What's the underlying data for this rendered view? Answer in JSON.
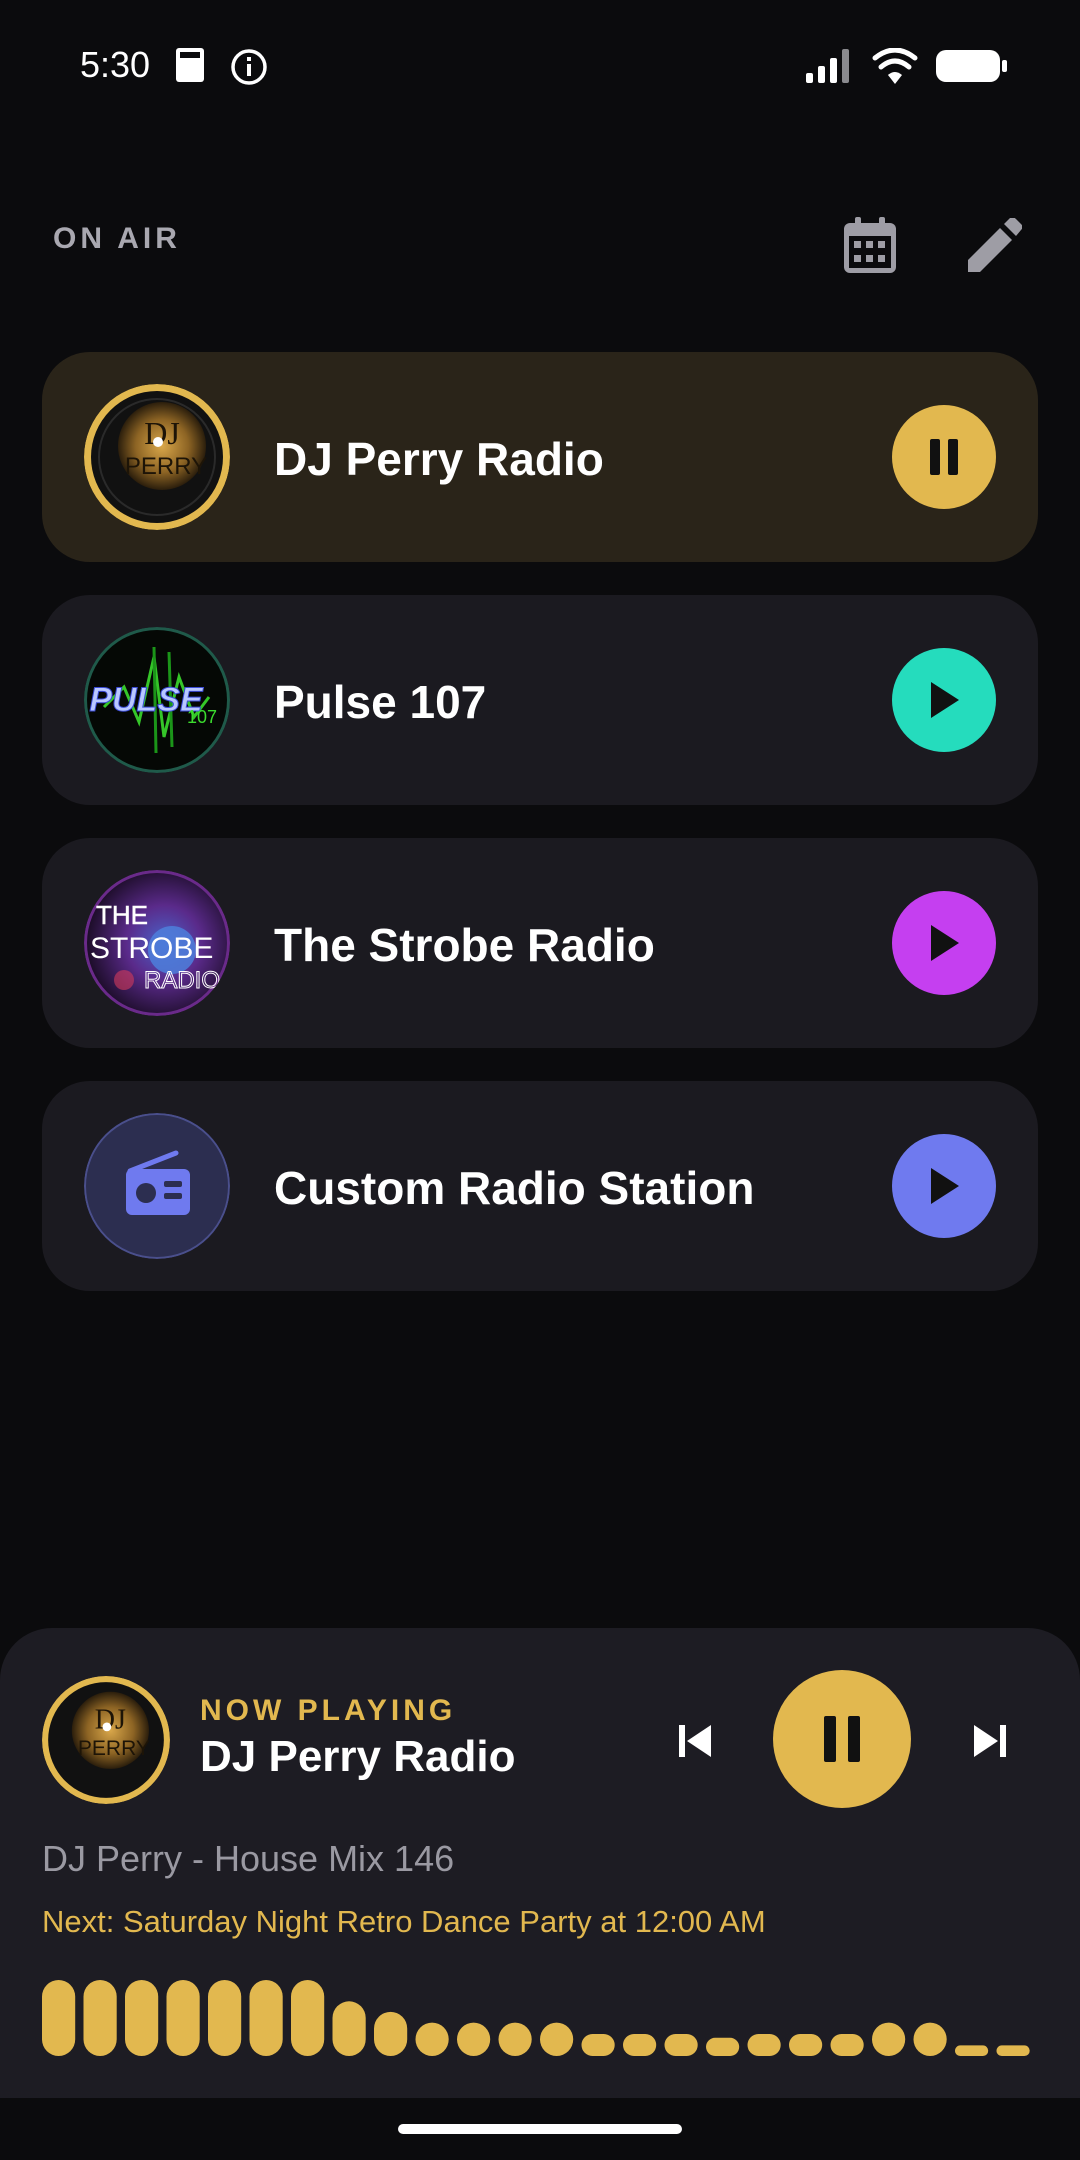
{
  "status_bar": {
    "time": "5:30",
    "icons": [
      "sim-card-icon",
      "info-icon",
      "signal-icon",
      "wifi-icon",
      "battery-icon"
    ]
  },
  "header": {
    "title": "ON AIR",
    "calendar_icon": "calendar-icon",
    "edit_icon": "pencil-icon"
  },
  "stations": [
    {
      "name": "DJ Perry Radio",
      "state": "playing",
      "accent": "#e2b84f",
      "logo_text": [
        "DJ",
        "PERRY"
      ]
    },
    {
      "name": "Pulse 107",
      "state": "paused",
      "accent": "#25dcbd",
      "logo_text": [
        "PULSE",
        "107"
      ]
    },
    {
      "name": "The Strobe Radio",
      "state": "paused",
      "accent": "#c53ff0",
      "logo_text": [
        "THE",
        "STROBE",
        "RADIO"
      ]
    },
    {
      "name": "Custom Radio Station",
      "state": "paused",
      "accent": "#6f7aef",
      "logo_icon": "radio-icon"
    }
  ],
  "player": {
    "label": "NOW PLAYING",
    "station": "DJ Perry Radio",
    "track": "DJ Perry - House Mix 146",
    "next": "Next: Saturday Night Retro Dance Party at 12:00 AM",
    "accent": "#e2b84f",
    "visualizer_levels": [
      1.0,
      1.0,
      1.0,
      1.0,
      1.0,
      1.0,
      1.0,
      0.72,
      0.58,
      0.44,
      0.44,
      0.44,
      0.44,
      0.29,
      0.29,
      0.29,
      0.24,
      0.29,
      0.29,
      0.29,
      0.44,
      0.44,
      0.14,
      0.14
    ]
  }
}
